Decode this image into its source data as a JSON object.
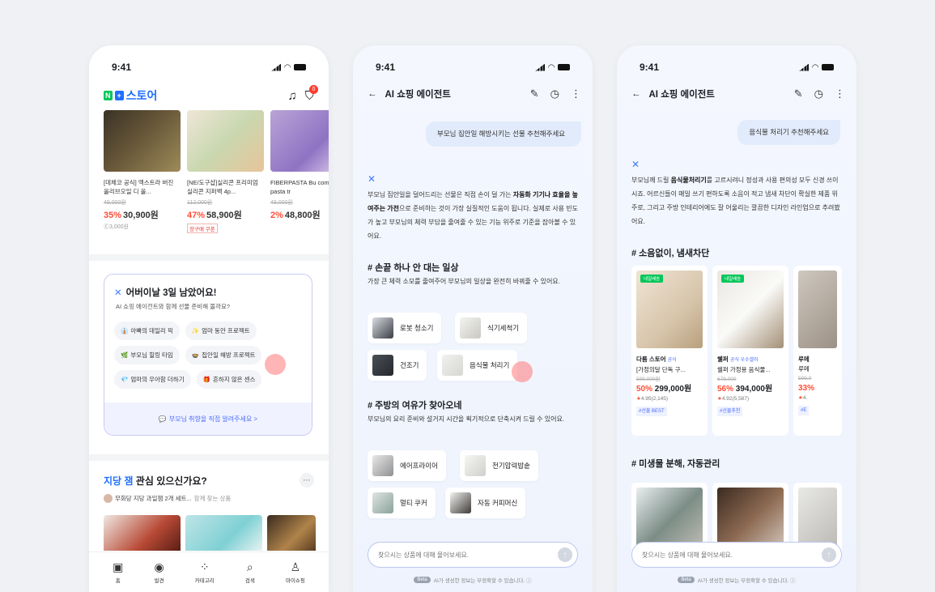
{
  "status_time": "9:41",
  "store": {
    "logo_n": "N",
    "logo_plus": "+",
    "logo_text": "스토어",
    "cart_count": "0",
    "products": [
      {
        "name": "[데체코 공식] 엑스트라 버진 올리브오일 디 올...",
        "orig": "49,000원",
        "pct": "35%",
        "price": "30,900원",
        "sub": "Ⓒ3,000원",
        "coupon": ""
      },
      {
        "name": "[NE/도구샵]실리콘 프리미엄 실리콘 지퍼백 4p...",
        "orig": "112,000원",
        "pct": "47%",
        "price": "58,900원",
        "sub": "",
        "coupon": "장구매 쿠폰"
      },
      {
        "name": "FIBERPASTA Bu come la pasta tr",
        "orig": "49,000원",
        "pct": "2%",
        "price": "48,800원",
        "sub": "",
        "coupon": ""
      }
    ],
    "promo": {
      "title": "어버이날 3일 남았어요!",
      "subtitle": "AI 쇼핑 에이전트와 함께 선물 준비해 볼까요?",
      "chips": [
        "아빠의 데일리 픽",
        "엄마 동안 프로젝트",
        "부모님 힐링 타임",
        "집안일 해방 프로젝트",
        "엄마의 우아함 더하기",
        "흔하지 않은 센스"
      ],
      "footer": "부모님 취향을 직접 알려주세요 >"
    },
    "section": {
      "title_hl": "지당 잼",
      "title_rest": " 관심 있으신가요?",
      "more": "···",
      "sub_main": "무화당 지당 과일잼 2개 세트...",
      "sub_gray": " 함께 찾는 상품"
    },
    "tabs": [
      "홈",
      "발견",
      "카테고리",
      "검색",
      "마이쇼핑"
    ]
  },
  "chat1": {
    "title": "AI 쇼핑 에이전트",
    "user_msg": "부모님 집안일 해방시키는 선물 추천해주세요",
    "reply_pre": "부모님 집안일을 덜어드리는 선물은 직접 손이 덜 가는 ",
    "reply_bold": "자동화 기기나 효율을 높여주는 가전",
    "reply_post": "으로 준비하는 것이 가장 실질적인 도움이 됩니다. 실제로 사용 빈도가 높고 부모님의 체력 부담을 줄여줄 수 있는 기능 위주로 기준을 잡아볼 수 있어요.",
    "sec1_title": "# 손끝 하나 안 대는 일상",
    "sec1_sub": "가장 큰 체력 소모를 줄여주어 부모님의 일상을 완전히 바꿔줄 수 있어요.",
    "sec1_items": [
      "로봇 청소기",
      "식기세척기",
      "건조기",
      "음식물 처리기"
    ],
    "sec2_title": "# 주방의 여유가 찾아오네",
    "sec2_sub": "부모님의 요리 준비와 설거지 시간을 획기적으로 단축시켜 드릴 수 있어요.",
    "sec2_items": [
      "에어프라이어",
      "전기압력밥솥",
      "멀티 쿠커",
      "자동 커피머신"
    ],
    "input_placeholder": "찾으시는 상품에 대해 물어보세요.",
    "beta": "Beta",
    "disclaimer": "AI가 생성한 정보는 부정확할 수 있습니다. ⓘ"
  },
  "chat2": {
    "title": "AI 쇼핑 에이전트",
    "user_msg": "음식물 처리기 추천해주세요",
    "reply_pre": "부모님께 드릴 ",
    "reply_bold1": "음식물처리기",
    "reply_mid": "를 고르시려니 정성과 사용 편의성 모두 신경 쓰이시죠. 어르신들이 매일 쓰기 편하도록 소음이 적고 냄새 차단이 확실한 제품 위주로, 그리고 주방 인테리어에도 잘 어울리는 깔끔한 디자인 라인업으로 추려봤어요.",
    "sec1_title": "# 소음없이, 냄새차단",
    "cards": [
      {
        "badge": "내일배송",
        "store": "다룸 스토어",
        "tag": "공식",
        "name": "[가정의달 단독 구...",
        "orig": "599,000원",
        "pct": "50%",
        "price": "299,000원",
        "rate": "4.95",
        "count": "(2,145)",
        "label": "#선물 BEST"
      },
      {
        "badge": "내일배송",
        "store": "쉘퍼",
        "tag": "공식 우수셀러",
        "name": "쉘퍼 가정용 음식물...",
        "orig": "679,000",
        "pct": "56%",
        "price": "394,000원",
        "rate": "4.92",
        "count": "(5,587)",
        "label": "#선물추천"
      },
      {
        "badge": "",
        "store": "루메",
        "tag": "",
        "name": "루메",
        "orig": "599,0",
        "pct": "33%",
        "price": "",
        "rate": "4.",
        "count": "",
        "label": "#E"
      }
    ],
    "sec2_title": "# 미생물 분해, 자동관리",
    "input_placeholder": "찾으시는 상품에 대해 물어보세요.",
    "beta": "Beta",
    "disclaimer": "AI가 생성한 정보는 부정확할 수 있습니다. ⓘ"
  },
  "colors": {
    "accent": "#1f6fff",
    "sale": "#ff4d36",
    "naver_green": "#03c75a"
  }
}
